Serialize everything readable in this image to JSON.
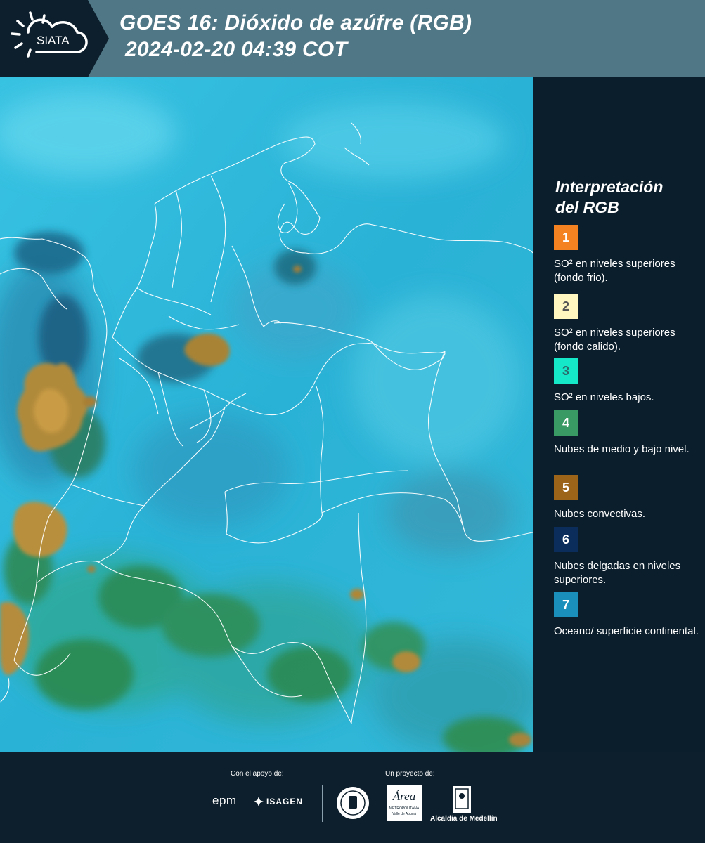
{
  "header": {
    "logo_text": "SIATA",
    "title_line1": "GOES 16: Dióxido de azúfre (RGB)",
    "title_line2": "2024-02-20 04:39 COT"
  },
  "legend": {
    "title_line1": "Interpretación",
    "title_line2": "del RGB",
    "items": [
      {
        "number": "1",
        "label": "SO² en niveles superiores (fondo frio).",
        "color": "#f58220",
        "text_color": "#ffffff"
      },
      {
        "number": "2",
        "label": "SO² en niveles superiores (fondo calido).",
        "color": "#fff6c0",
        "text_color": "#555555"
      },
      {
        "number": "3",
        "label": "SO² en niveles bajos.",
        "color": "#14e8c8",
        "text_color": "#2a6a6a"
      },
      {
        "number": "4",
        "label": "Nubes de medio y bajo nivel.",
        "color": "#3a9a63",
        "text_color": "#ffffff"
      },
      {
        "number": "5",
        "label": "Nubes convectivas.",
        "color": "#9c6418",
        "text_color": "#ffffff"
      },
      {
        "number": "6",
        "label": "Nubes delgadas en niveles superiores.",
        "color": "#0a2d5c",
        "text_color": "#ffffff"
      },
      {
        "number": "7",
        "label": "Oceano/ superficie continental.",
        "color": "#1a8fbc",
        "text_color": "#ffffff"
      }
    ]
  },
  "footer": {
    "support_label": "Con el apoyo de:",
    "project_label": "Un proyecto de:",
    "sponsor1": "epm",
    "sponsor2": "ISAGEN",
    "partner_area": "Área",
    "partner_area_sub": "METROPOLITANA",
    "partner_area_sub2": "Valle de Aburrá",
    "partner_alcaldia": "Alcaldía de Medellín"
  },
  "colors": {
    "header_bg": "#4f7785",
    "panel_bg": "#0b1e2b",
    "map_base": "#2fb8d8",
    "border_lines": "#ffffff"
  }
}
